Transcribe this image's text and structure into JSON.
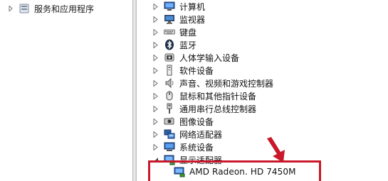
{
  "left_pane": {
    "item_label": "服务和应用程序"
  },
  "tree": {
    "items": [
      {
        "label": "计算机",
        "icon": "computer-icon"
      },
      {
        "label": "监视器",
        "icon": "monitor-icon"
      },
      {
        "label": "键盘",
        "icon": "keyboard-icon"
      },
      {
        "label": "蓝牙",
        "icon": "bluetooth-icon"
      },
      {
        "label": "人体学输入设备",
        "icon": "hid-icon"
      },
      {
        "label": "软件设备",
        "icon": "software-device-icon"
      },
      {
        "label": "声音、视频和游戏控制器",
        "icon": "speaker-icon"
      },
      {
        "label": "鼠标和其他指针设备",
        "icon": "mouse-icon"
      },
      {
        "label": "通用串行总线控制器",
        "icon": "usb-icon"
      },
      {
        "label": "图像设备",
        "icon": "camera-icon"
      },
      {
        "label": "网络适配器",
        "icon": "network-icon"
      },
      {
        "label": "系统设备",
        "icon": "system-device-icon"
      },
      {
        "label": "显示适配器",
        "icon": "display-adapter-icon",
        "expanded": true
      }
    ],
    "children": [
      {
        "label": "AMD Radeon. HD 7450M",
        "icon": "display-adapter-icon"
      }
    ]
  },
  "annotation": {
    "color": "#c8182a"
  }
}
